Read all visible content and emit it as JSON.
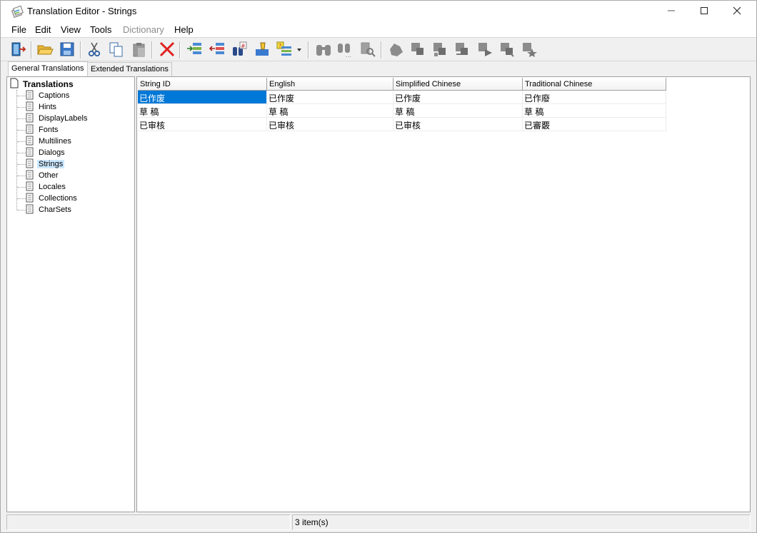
{
  "window": {
    "title": "Translation Editor - Strings",
    "controls": {
      "minimize": "minimize-icon",
      "maximize": "maximize-icon",
      "close": "close-icon"
    }
  },
  "menu": [
    {
      "label": "File",
      "enabled": true
    },
    {
      "label": "Edit",
      "enabled": true
    },
    {
      "label": "View",
      "enabled": true
    },
    {
      "label": "Tools",
      "enabled": true
    },
    {
      "label": "Dictionary",
      "enabled": false
    },
    {
      "label": "Help",
      "enabled": true
    }
  ],
  "toolbar": {
    "buttons": [
      {
        "icon": "exit-icon",
        "enabled": true
      },
      {
        "icon": "open-folder-icon",
        "enabled": true
      },
      {
        "icon": "save-icon",
        "enabled": true
      },
      {
        "icon": "cut-icon",
        "enabled": true
      },
      {
        "icon": "copy-icon",
        "enabled": true
      },
      {
        "icon": "paste-icon",
        "enabled": false
      },
      {
        "icon": "delete-icon",
        "enabled": true
      },
      {
        "icon": "add-row-icon",
        "enabled": true
      },
      {
        "icon": "remove-row-icon",
        "enabled": true
      },
      {
        "icon": "find-replace-icon",
        "enabled": true
      },
      {
        "icon": "highlight-icon",
        "enabled": true
      },
      {
        "icon": "list-options-icon",
        "enabled": true
      },
      {
        "icon": "find-icon",
        "enabled": false
      },
      {
        "icon": "find-next-icon",
        "enabled": false
      },
      {
        "icon": "go-to-icon",
        "enabled": false
      },
      {
        "icon": "dictionary-icon",
        "enabled": false
      },
      {
        "icon": "translate-icon",
        "enabled": false
      },
      {
        "icon": "translate-all-icon",
        "enabled": false
      },
      {
        "icon": "translate-forward-icon",
        "enabled": false
      },
      {
        "icon": "translate-next-icon",
        "enabled": false
      },
      {
        "icon": "translate-done-icon",
        "enabled": false
      },
      {
        "icon": "translate-star-icon",
        "enabled": false
      }
    ]
  },
  "tabs": [
    {
      "label": "General Translations",
      "active": true
    },
    {
      "label": "Extended Translations",
      "active": false
    }
  ],
  "tree": {
    "root": "Translations",
    "items": [
      {
        "label": "Captions",
        "selected": false
      },
      {
        "label": "Hints",
        "selected": false
      },
      {
        "label": "DisplayLabels",
        "selected": false
      },
      {
        "label": "Fonts",
        "selected": false
      },
      {
        "label": "Multilines",
        "selected": false
      },
      {
        "label": "Dialogs",
        "selected": false
      },
      {
        "label": "Strings",
        "selected": true
      },
      {
        "label": "Other",
        "selected": false
      },
      {
        "label": "Locales",
        "selected": false
      },
      {
        "label": "Collections",
        "selected": false
      },
      {
        "label": "CharSets",
        "selected": false
      }
    ]
  },
  "grid": {
    "columns": [
      "String ID",
      "English",
      "Simplified Chinese",
      "Traditional Chinese"
    ],
    "rows": [
      [
        "已作废",
        "已作废",
        "已作废",
        "已作廢"
      ],
      [
        "草 稿",
        "草 稿",
        "草 稿",
        "草 稿"
      ],
      [
        "已审核",
        "已审核",
        "已审核",
        "已審覈"
      ]
    ],
    "selected_cell": {
      "row": 0,
      "col": 0
    }
  },
  "status": {
    "item_count": "3 item(s)"
  },
  "colors": {
    "selection": "#0078d7",
    "tree_selection": "#cce8ff",
    "delete_red": "#e02020"
  }
}
